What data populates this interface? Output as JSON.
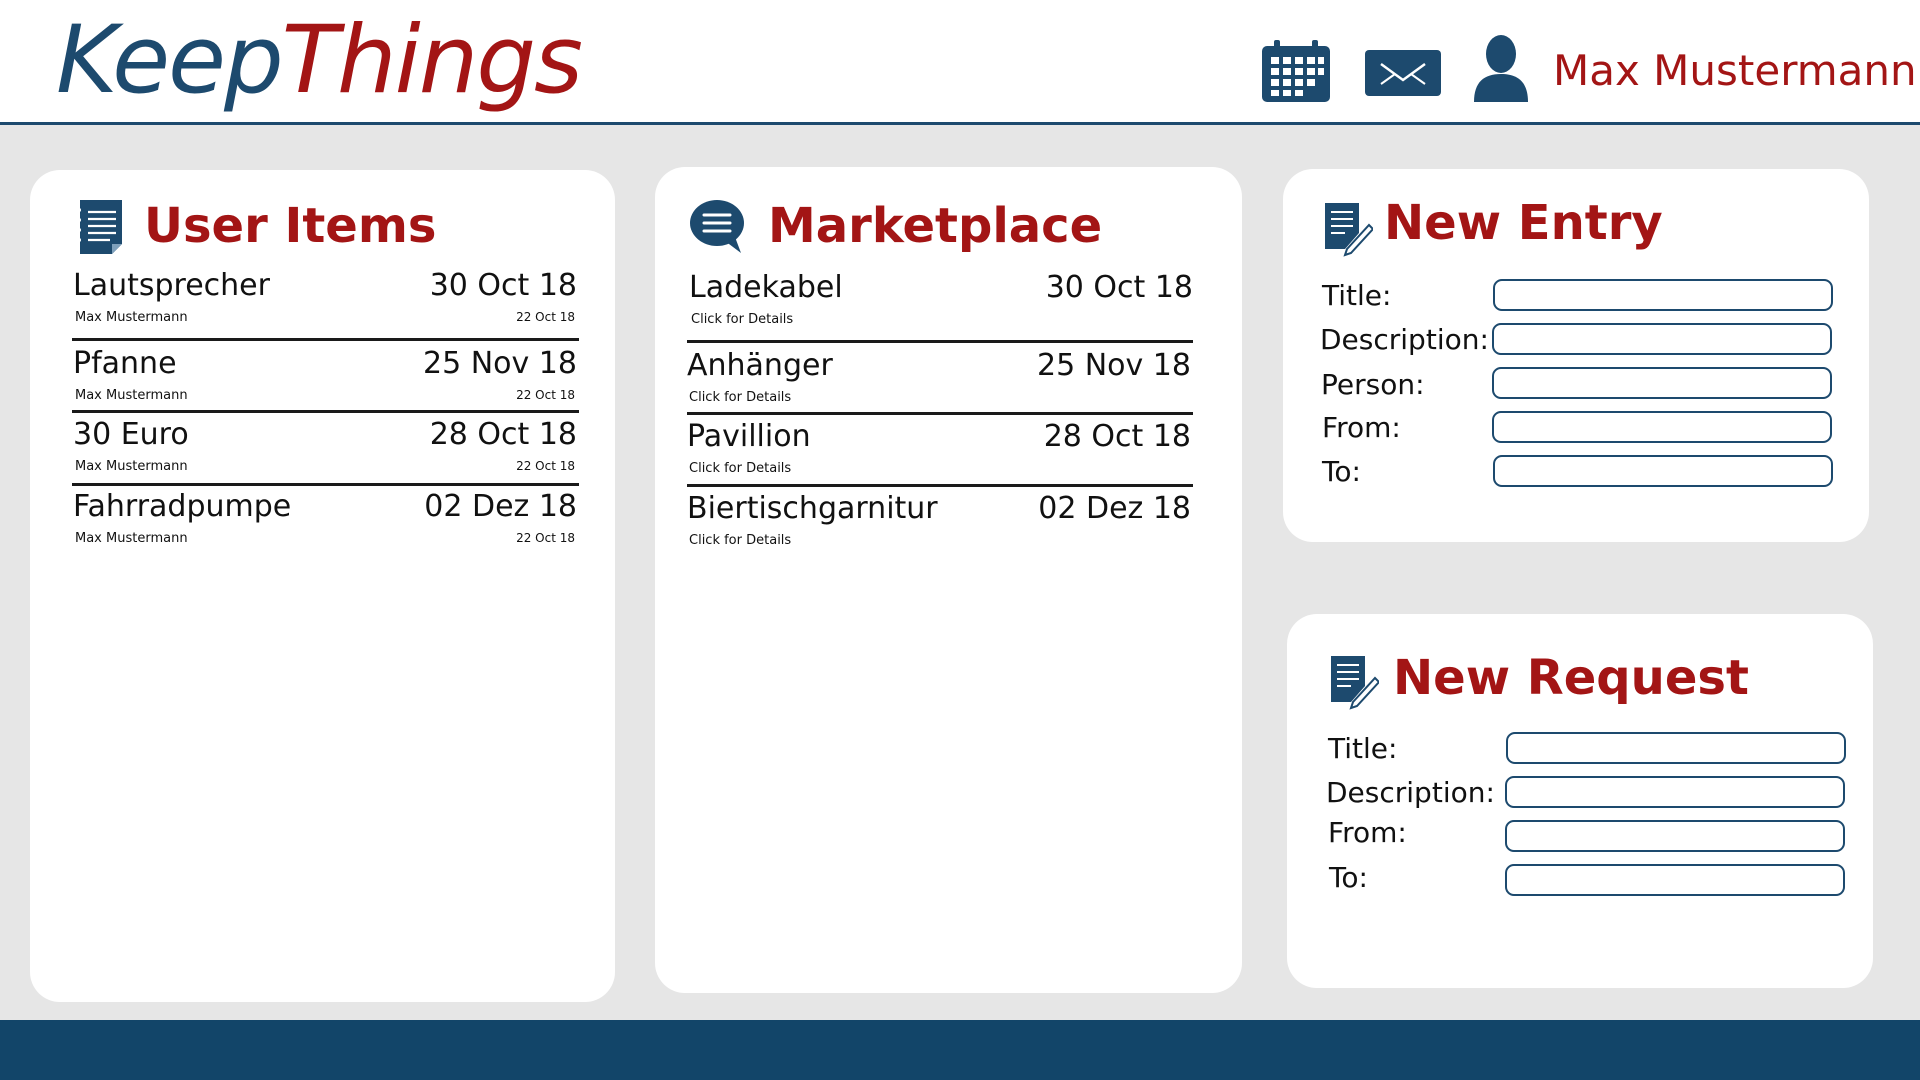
{
  "app": {
    "logo_part1": "Keep",
    "logo_part2": "Things",
    "user_name": "Max Mustermann",
    "colors": {
      "primary": "#1d4a6e",
      "accent": "#a31515",
      "footer": "#124569",
      "background": "#e6e6e6"
    },
    "icons": [
      "calendar-icon",
      "mail-icon",
      "user-icon"
    ]
  },
  "user_items": {
    "title": "User Items",
    "icon": "notepad-list-icon",
    "items": [
      {
        "name": "Lautsprecher",
        "date": "30 Oct 18",
        "owner": "Max Mustermann",
        "sub_date": "22 Oct 18"
      },
      {
        "name": "Pfanne",
        "date": "25 Nov 18",
        "owner": "Max Mustermann",
        "sub_date": "22 Oct 18"
      },
      {
        "name": "30 Euro",
        "date": "28 Oct 18",
        "owner": "Max Mustermann",
        "sub_date": "22 Oct 18"
      },
      {
        "name": "Fahrradpumpe",
        "date": "02 Dez 18",
        "owner": "Max Mustermann",
        "sub_date": "22 Oct 18"
      }
    ]
  },
  "marketplace": {
    "title": "Marketplace",
    "icon": "chat-bubble-icon",
    "items": [
      {
        "name": "Ladekabel",
        "date": "30 Oct 18",
        "hint": "Click for Details"
      },
      {
        "name": "Anhänger",
        "date": "25 Nov 18",
        "hint": "Click for Details"
      },
      {
        "name": "Pavillion",
        "date": "28 Oct 18",
        "hint": "Click for Details"
      },
      {
        "name": "Biertischgarnitur",
        "date": "02 Dez 18",
        "hint": "Click for Details"
      }
    ]
  },
  "new_entry": {
    "title": "New Entry",
    "icon": "edit-document-icon",
    "fields": [
      {
        "label": "Title:",
        "value": "",
        "placeholder": ""
      },
      {
        "label": "Description:",
        "value": "",
        "placeholder": ""
      },
      {
        "label": "Person:",
        "value": "",
        "placeholder": ""
      },
      {
        "label": "From:",
        "value": "",
        "placeholder": ""
      },
      {
        "label": "To:",
        "value": "",
        "placeholder": ""
      }
    ]
  },
  "new_request": {
    "title": "New Request",
    "icon": "edit-document-icon",
    "fields": [
      {
        "label": "Title:",
        "value": "",
        "placeholder": ""
      },
      {
        "label": "Description:",
        "value": "",
        "placeholder": ""
      },
      {
        "label": "From:",
        "value": "",
        "placeholder": ""
      },
      {
        "label": "To:",
        "value": "",
        "placeholder": ""
      }
    ]
  }
}
